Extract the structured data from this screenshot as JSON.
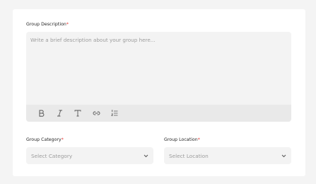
{
  "description": {
    "label": "Group Description",
    "required_mark": "*",
    "placeholder": "Write a brief description about your group here..."
  },
  "toolbar": {
    "tools": [
      "bold-icon",
      "italic-icon",
      "text-format-icon",
      "link-icon",
      "ordered-list-icon"
    ]
  },
  "category": {
    "label": "Group Category",
    "required_mark": "*",
    "placeholder": "Select Category"
  },
  "location": {
    "label": "Group Location",
    "required_mark": "*",
    "placeholder": "Select Location"
  },
  "colors": {
    "required": "#e53935",
    "field_background": "#f3f3f3",
    "toolbar_background": "#e9e9e9",
    "page_background": "#f4f4f4"
  }
}
